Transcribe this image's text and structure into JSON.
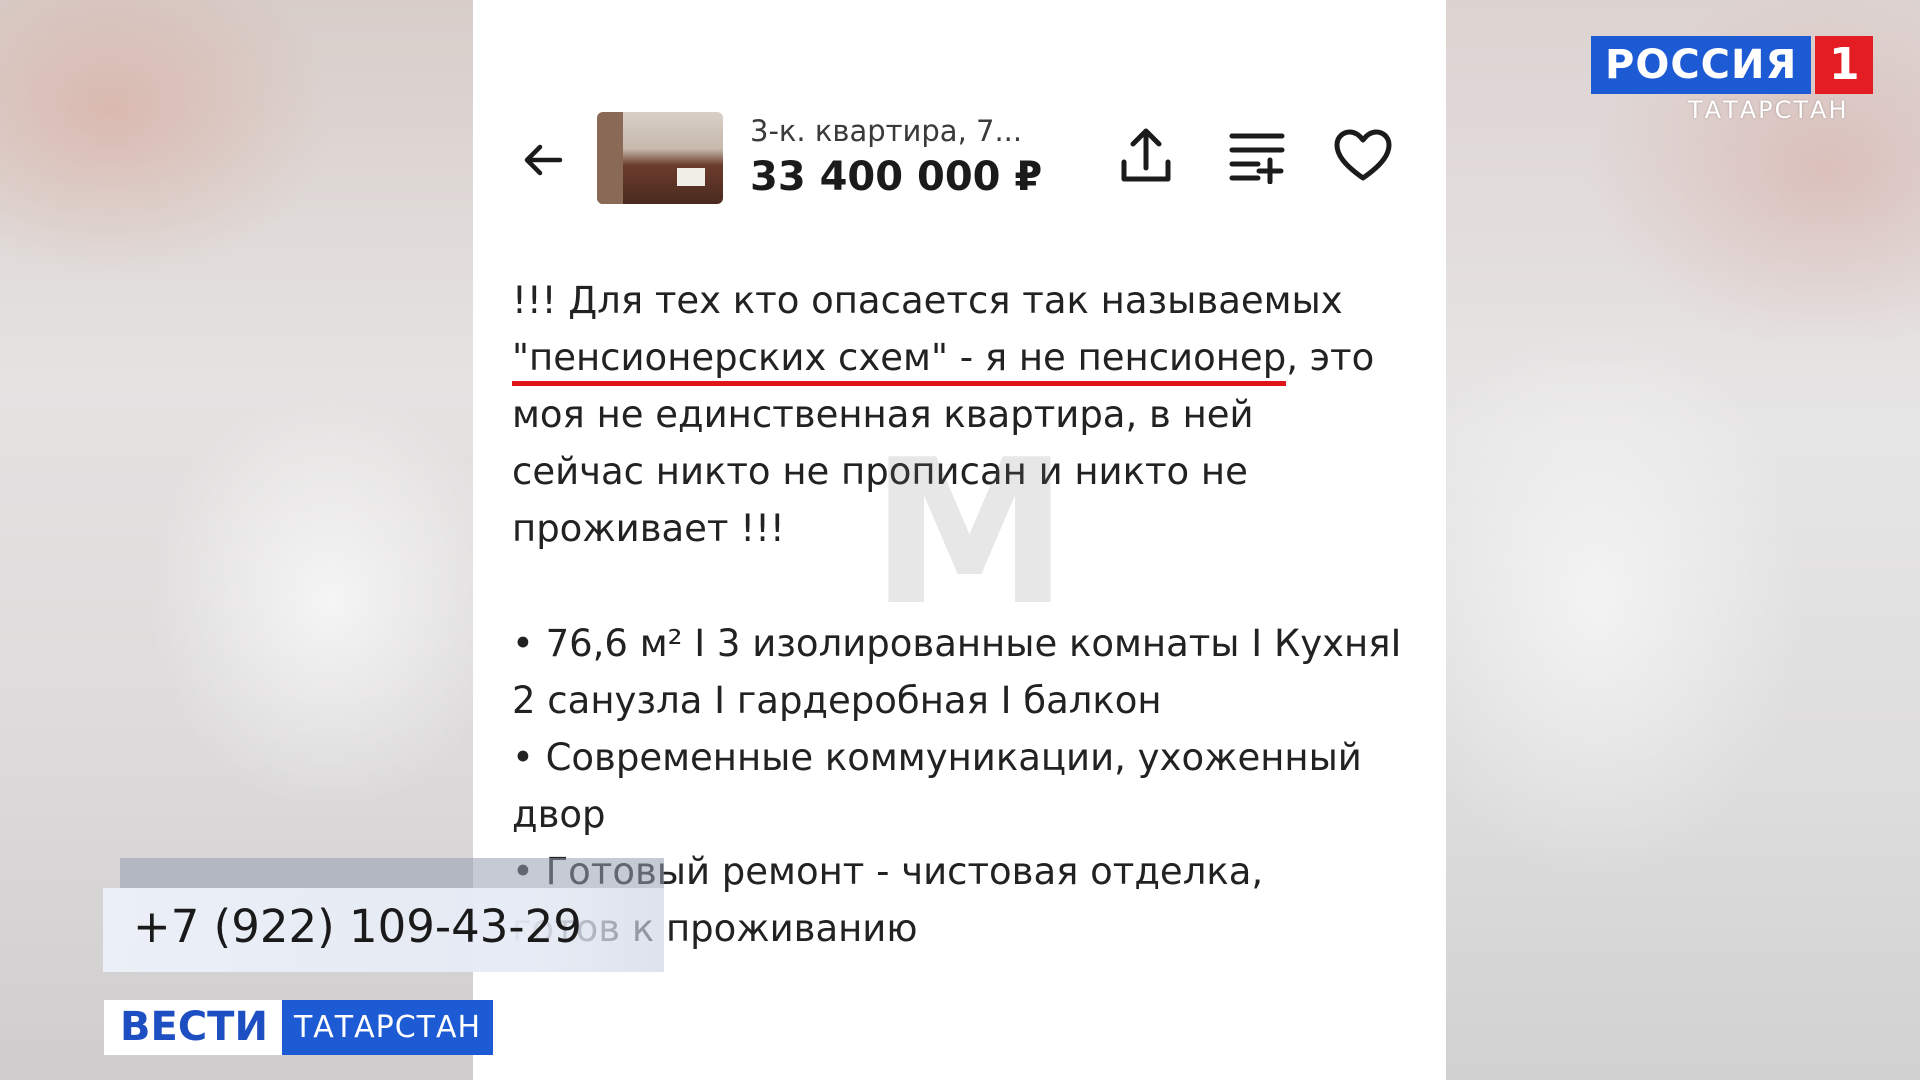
{
  "channel": {
    "logo_word": "РОССИЯ",
    "logo_number": "1",
    "region": "ТАТАРСТАН"
  },
  "listing": {
    "title": "3-к. квартира, 7...",
    "price": "33 400 000 ₽"
  },
  "icons": {
    "back": "arrow-left-icon",
    "share": "share-icon",
    "compare": "compare-list-icon",
    "favorite": "heart-icon"
  },
  "description": {
    "line1": "!!! Для тех кто опасается так называемых",
    "line2_highlight": "\"пенсионерских схем\" - я не пенсионер",
    "line2_rest": ", это",
    "line3": "моя не единственная квартира, в ней",
    "line4": "сейчас никто не прописан и никто не",
    "line5": "проживает !!!"
  },
  "bullets": {
    "b1_line1": "• 76,6 м² I 3 изолированные комнаты I КухняI",
    "b1_line2": "2 санузла I гардеробная I балкон",
    "b2_line1": "• Современные коммуникации, ухоженный",
    "b2_line2": "двор",
    "b3_line1": "• Готовый ремонт - чистовая отделка,",
    "b3_line2": "готов к проживанию"
  },
  "watermark": "M",
  "contact": {
    "phone": "+7 (922) 109-43-29"
  },
  "program": {
    "name": "ВЕСТИ",
    "region": "ТАТАРСТАН"
  },
  "colors": {
    "highlight_underline": "#e0151b",
    "russia_blue": "#1d5bd4",
    "russia_red": "#e41c24"
  }
}
